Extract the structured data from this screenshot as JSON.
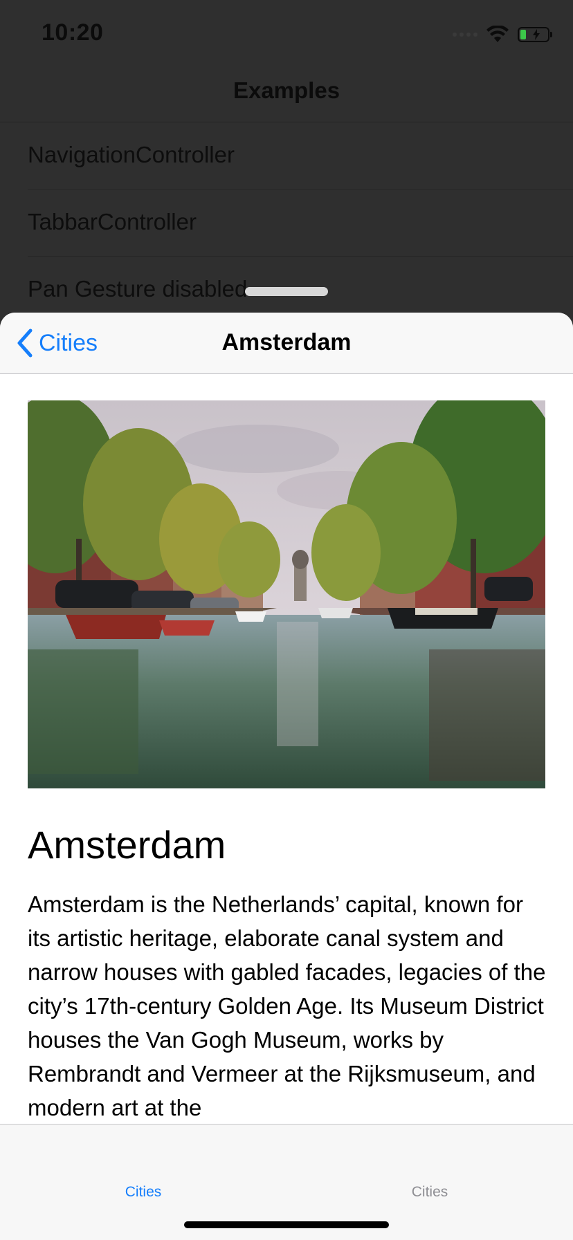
{
  "status_bar": {
    "time": "10:20",
    "icons": [
      "signal-dots-icon",
      "wifi-icon",
      "battery-charging-icon"
    ]
  },
  "background_screen": {
    "title": "Examples",
    "rows": [
      {
        "label": "NavigationController"
      },
      {
        "label": "TabbarController"
      },
      {
        "label": "Pan Gesture disabled"
      }
    ]
  },
  "sheet": {
    "nav": {
      "back_label": "Cities",
      "title": "Amsterdam"
    },
    "content": {
      "image_description": "Amsterdam canal with trees, parked cars and boats reflected in water",
      "heading": "Amsterdam",
      "description": "Amsterdam is the Netherlands’ capital, known for its artistic heritage, elaborate canal system and narrow houses with gabled facades, legacies of the city’s 17th-century Golden Age. Its Museum District houses the Van Gogh Museum, works by Rembrandt and Vermeer at the Rijksmuseum, and modern art at the"
    }
  },
  "tab_bar": {
    "tabs": [
      {
        "label": "Cities",
        "active": true
      },
      {
        "label": "Cities",
        "active": false
      }
    ]
  },
  "colors": {
    "accent": "#157efb",
    "inactive_tab": "#8e8e93",
    "dimmed_background": "#2f2f2f",
    "battery_green": "#3cc84a"
  }
}
